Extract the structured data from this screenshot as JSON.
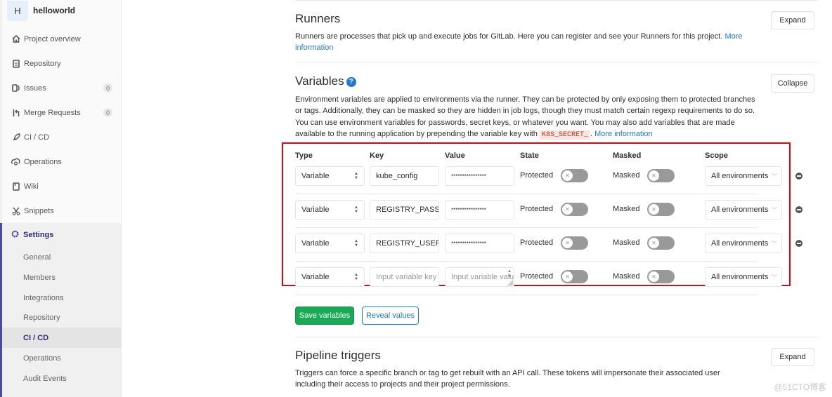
{
  "sidebar": {
    "project": {
      "avatar_letter": "H",
      "name": "helloworld"
    },
    "items": [
      {
        "label": "Project overview",
        "icon": "home-icon"
      },
      {
        "label": "Repository",
        "icon": "doc-icon"
      },
      {
        "label": "Issues",
        "icon": "issues-icon",
        "count": "0"
      },
      {
        "label": "Merge Requests",
        "icon": "merge-request-icon",
        "count": "0"
      },
      {
        "label": "CI / CD",
        "icon": "rocket-icon"
      },
      {
        "label": "Operations",
        "icon": "cloud-gear-icon"
      },
      {
        "label": "Wiki",
        "icon": "book-icon"
      },
      {
        "label": "Snippets",
        "icon": "scissors-icon"
      }
    ],
    "settings": {
      "label": "Settings",
      "icon": "gear-icon",
      "subitems": [
        {
          "label": "General"
        },
        {
          "label": "Members"
        },
        {
          "label": "Integrations"
        },
        {
          "label": "Repository"
        },
        {
          "label": "CI / CD",
          "active": true
        },
        {
          "label": "Operations"
        },
        {
          "label": "Audit Events"
        }
      ]
    }
  },
  "runners": {
    "title": "Runners",
    "description": "Runners are processes that pick up and execute jobs for GitLab. Here you can register and see your Runners for this project.",
    "link": "More information",
    "button": "Expand"
  },
  "variables": {
    "title": "Variables",
    "help_icon": "question-circle-icon",
    "description_1": "Environment variables are applied to environments via the runner. They can be protected by only exposing them to protected branches or tags. Additionally, they can be masked so they are hidden in job logs, though they must match certain regexp requirements to do so. You can use environment variables for passwords, secret keys, or whatever you want. You may also add variables that are made available to the running application by prepending the variable key with",
    "code": "K8S_SECRET_",
    "description_2": ".",
    "link": "More information",
    "button": "Collapse",
    "columns": {
      "type": "Type",
      "key": "Key",
      "value": "Value",
      "state": "State",
      "masked": "Masked",
      "scope": "Scope"
    },
    "rows": [
      {
        "type": "Variable",
        "key": "kube_config",
        "value": "****************",
        "state_label": "Protected",
        "protected": false,
        "masked_label": "Masked",
        "masked": false,
        "scope": "All environments",
        "removable": true
      },
      {
        "type": "Variable",
        "key": "REGISTRY_PASSW",
        "value": "****************",
        "state_label": "Protected",
        "protected": false,
        "masked_label": "Masked",
        "masked": false,
        "scope": "All environments",
        "removable": true
      },
      {
        "type": "Variable",
        "key": "REGISTRY_USERN",
        "value": "****************",
        "state_label": "Protected",
        "protected": false,
        "masked_label": "Masked",
        "masked": false,
        "scope": "All environments",
        "removable": true
      },
      {
        "type": "Variable",
        "key": "",
        "key_placeholder": "Input variable key",
        "value": "",
        "value_placeholder": "Input variable value",
        "state_label": "Protected",
        "protected": false,
        "masked_label": "Masked",
        "masked": false,
        "scope": "All environments",
        "removable": false
      }
    ],
    "save_button": "Save variables",
    "reveal_button": "Reveal values"
  },
  "pipeline_triggers": {
    "title": "Pipeline triggers",
    "description": "Triggers can force a specific branch or tag to get rebuilt with an API call. These tokens will impersonate their associated user including their access to projects and their project permissions.",
    "button": "Expand"
  },
  "watermark": "@51CTO博客",
  "colors": {
    "accent": "#1f78d1",
    "save": "#1aaa55",
    "highlight_box": "#e4000f",
    "sidebar_active": "#4b4ba3"
  }
}
